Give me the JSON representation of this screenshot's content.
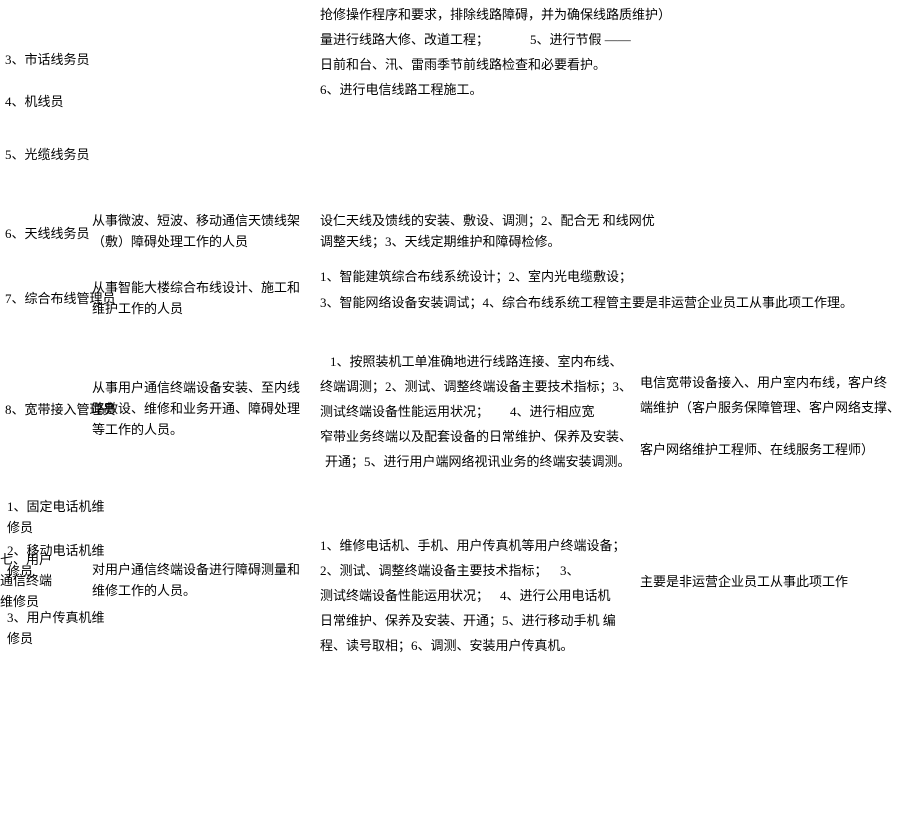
{
  "items": {
    "line3": "3、市话线务员",
    "line4": "4、机线员",
    "line5": "5、光缆线务员",
    "line6": "6、天线线务员",
    "line7": "7、综合布线管理员",
    "line8": "8、宽带接入管理员",
    "sub7_1": "1、固定电话机维修员",
    "sub7_2": "2、移动电话机维修员",
    "sub7_3": "3、用户传真机维修员",
    "cat7": "七、用户通信终端维修员"
  },
  "desc": {
    "d6": "从事微波、短波、移动通信天馈线架（敷）障碍处理工作的人员",
    "d7": "从事智能大楼综合布线设计、施工和维护工作的人员",
    "d8": "从事用户通信终端设备安装、至内线路敷设、维修和业务开通、障碍处理等工作的人员。",
    "d_sub": "对用户通信终端设备进行障碍测量和维修工作的人员。"
  },
  "tasks": {
    "t_top1": "抢修操作程序和要求，排除线路障碍，并为确保线路质维护）",
    "t_top2": "量进行线路大修、改道工程；",
    "t_top2b": "5、进行节假 ——",
    "t_top3": "日前和台、汛、雷雨季节前线路检查和必要看护。",
    "t_top4": "6、进行电信线路工程施工。",
    "t6": "设仁天线及馈线的安装、敷设、调测；2、配合无 和线网优调整天线；3、天线定期维护和障碍检修。",
    "t7a": "1、智能建筑综合布线系统设计；2、室内光电缆敷设；",
    "t7b": "3、智能网络设备安装调试；4、综合布线系统工程管主要是非运营企业员工从事此项工作理。",
    "t8a": "1、按照装机工单准确地进行线路连接、室内布线、",
    "t8b": "终端调测；2、测试、调整终端设备主要技术指标；3、",
    "t8c": "测试终端设备性能运用状况；",
    "t8c2": "4、进行相应宽",
    "t8d": "窄带业务终端以及配套设备的日常维护、保养及安装、",
    "t8e": "开通；5、进行用户端网络视讯业务的终端安装调测。",
    "t_sub1": "1、维修电话机、手机、用户传真机等用户终端设备；",
    "t_sub2": "2、测试、调整终端设备主要技术指标；",
    "t_sub2b": "3、",
    "t_sub3": "测试终端设备性能运用状况；",
    "t_sub3b": "4、进行公用电话机",
    "t_sub4": "日常维护、保养及安装、开通；5、进行移动手机 编",
    "t_sub5": "程、读号取相；6、调测、安装用户传真机。"
  },
  "remark": {
    "r8a": "电信宽带设备接入、用户室内布线，客户终",
    "r8b": "端维护（客户服务保障管理、客户网络支撑、",
    "r8c": "客户网络维护工程师、在线服务工程师）",
    "r_sub": "主要是非运营企业员工从事此项工作"
  }
}
